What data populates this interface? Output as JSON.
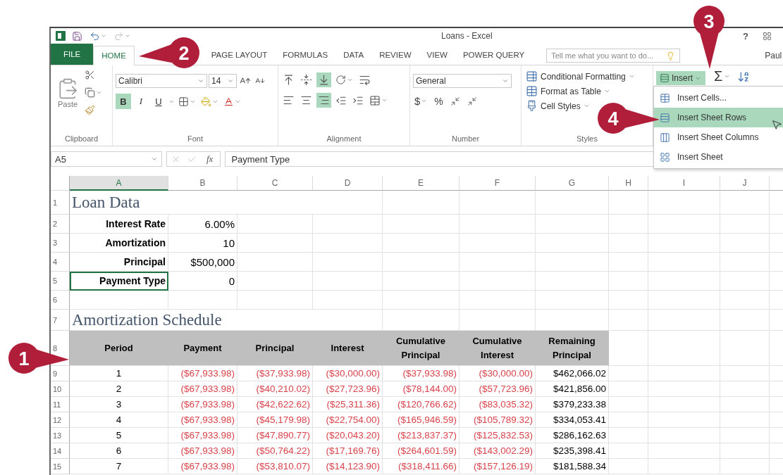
{
  "window": {
    "title": "Loans - Excel",
    "help": "?",
    "user": "Paul"
  },
  "tabs": [
    {
      "label": "FILE",
      "kind": "file",
      "selected": false
    },
    {
      "label": "HOME",
      "kind": "tab",
      "selected": true
    },
    {
      "label": "PAGE LAYOUT",
      "kind": "tab",
      "selected": false
    },
    {
      "label": "FORMULAS",
      "kind": "tab",
      "selected": false
    },
    {
      "label": "DATA",
      "kind": "tab",
      "selected": false
    },
    {
      "label": "REVIEW",
      "kind": "tab",
      "selected": false
    },
    {
      "label": "VIEW",
      "kind": "tab",
      "selected": false
    },
    {
      "label": "POWER QUERY",
      "kind": "tab",
      "selected": false
    }
  ],
  "tell_me": {
    "placeholder": "Tell me what you want to do..."
  },
  "ribbon": {
    "clipboard": {
      "paste": "Paste",
      "group": "Clipboard"
    },
    "font": {
      "name": "Calibri",
      "size": "14",
      "bold_label": "B",
      "italic_label": "I",
      "underline_label": "U",
      "bold": true,
      "group": "Font"
    },
    "alignment": {
      "vertical": [
        {
          "selected": false
        },
        {
          "selected": false
        },
        {
          "selected": true
        }
      ],
      "horizontal": [
        {
          "selected": false
        },
        {
          "selected": false
        },
        {
          "selected": true
        }
      ],
      "group": "Alignment"
    },
    "number": {
      "format": "General",
      "currency": "$",
      "percent": "%",
      "group": "Number"
    },
    "styles": {
      "items": [
        "Conditional Formatting",
        "Format as Table",
        "Cell Styles"
      ],
      "group": "Styles"
    },
    "cells": {
      "insert": "Insert",
      "open": true
    },
    "editing": {
      "sum": "Σ"
    }
  },
  "insert_menu": [
    {
      "label": "Insert Cells...",
      "selected": false
    },
    {
      "label": "Insert Sheet Rows",
      "selected": true
    },
    {
      "label": "Insert Sheet Columns",
      "selected": false
    },
    {
      "label": "Insert Sheet",
      "selected": false
    }
  ],
  "formula_bar": {
    "name_box": "A5",
    "function_label": "fx",
    "value": "Payment Type"
  },
  "columns": [
    {
      "label": "A",
      "selected": true
    },
    {
      "label": "B",
      "selected": false
    },
    {
      "label": "C",
      "selected": false
    },
    {
      "label": "D",
      "selected": false
    },
    {
      "label": "E",
      "selected": false
    },
    {
      "label": "F",
      "selected": false
    },
    {
      "label": "G",
      "selected": false
    },
    {
      "label": "H",
      "selected": false
    },
    {
      "label": "I",
      "selected": false
    },
    {
      "label": "J",
      "selected": false
    }
  ],
  "rows": [
    {
      "number": "1",
      "kind": "title",
      "cells": [
        "Loan Data"
      ]
    },
    {
      "number": "2",
      "kind": "param",
      "selected": false,
      "cells": [
        "Interest Rate",
        "6.00%"
      ]
    },
    {
      "number": "3",
      "kind": "param",
      "selected": false,
      "cells": [
        "Amortization",
        "10"
      ]
    },
    {
      "number": "4",
      "kind": "param",
      "selected": false,
      "cells": [
        "Principal",
        "$500,000"
      ]
    },
    {
      "number": "5",
      "kind": "param",
      "selected": true,
      "cells": [
        "Payment Type",
        "0"
      ]
    },
    {
      "number": "6",
      "kind": "blank"
    },
    {
      "number": "7",
      "kind": "title",
      "cells": [
        "Amortization Schedule"
      ]
    },
    {
      "number": "8",
      "kind": "header",
      "cells": [
        "Period",
        "Payment",
        "Principal",
        "Interest",
        "Cumulative Principal",
        "Cumulative Interest",
        "Remaining Principal"
      ]
    },
    {
      "number": "9",
      "kind": "data",
      "cells": [
        {
          "text": "1",
          "negative": false
        },
        {
          "text": "($67,933.98)",
          "negative": true
        },
        {
          "text": "($37,933.98)",
          "negative": true
        },
        {
          "text": "($30,000.00)",
          "negative": true
        },
        {
          "text": "($37,933.98)",
          "negative": true
        },
        {
          "text": "($30,000.00)",
          "negative": true
        },
        {
          "text": "$462,066.02",
          "negative": false
        }
      ]
    },
    {
      "number": "10",
      "kind": "data",
      "cells": [
        {
          "text": "2",
          "negative": false
        },
        {
          "text": "($67,933.98)",
          "negative": true
        },
        {
          "text": "($40,210.02)",
          "negative": true
        },
        {
          "text": "($27,723.96)",
          "negative": true
        },
        {
          "text": "($78,144.00)",
          "negative": true
        },
        {
          "text": "($57,723.96)",
          "negative": true
        },
        {
          "text": "$421,856.00",
          "negative": false
        }
      ]
    },
    {
      "number": "11",
      "kind": "data",
      "cells": [
        {
          "text": "3",
          "negative": false
        },
        {
          "text": "($67,933.98)",
          "negative": true
        },
        {
          "text": "($42,622.62)",
          "negative": true
        },
        {
          "text": "($25,311.36)",
          "negative": true
        },
        {
          "text": "($120,766.62)",
          "negative": true
        },
        {
          "text": "($83,035.32)",
          "negative": true
        },
        {
          "text": "$379,233.38",
          "negative": false
        }
      ]
    },
    {
      "number": "12",
      "kind": "data",
      "cells": [
        {
          "text": "4",
          "negative": false
        },
        {
          "text": "($67,933.98)",
          "negative": true
        },
        {
          "text": "($45,179.98)",
          "negative": true
        },
        {
          "text": "($22,754.00)",
          "negative": true
        },
        {
          "text": "($165,946.59)",
          "negative": true
        },
        {
          "text": "($105,789.32)",
          "negative": true
        },
        {
          "text": "$334,053.41",
          "negative": false
        }
      ]
    },
    {
      "number": "13",
      "kind": "data",
      "cells": [
        {
          "text": "5",
          "negative": false
        },
        {
          "text": "($67,933.98)",
          "negative": true
        },
        {
          "text": "($47,890.77)",
          "negative": true
        },
        {
          "text": "($20,043.20)",
          "negative": true
        },
        {
          "text": "($213,837.37)",
          "negative": true
        },
        {
          "text": "($125,832.53)",
          "negative": true
        },
        {
          "text": "$286,162.63",
          "negative": false
        }
      ]
    },
    {
      "number": "14",
      "kind": "data",
      "cells": [
        {
          "text": "6",
          "negative": false
        },
        {
          "text": "($67,933.98)",
          "negative": true
        },
        {
          "text": "($50,764.22)",
          "negative": true
        },
        {
          "text": "($17,169.76)",
          "negative": true
        },
        {
          "text": "($264,601.59)",
          "negative": true
        },
        {
          "text": "($143,002.29)",
          "negative": true
        },
        {
          "text": "$235,398.41",
          "negative": false
        }
      ]
    },
    {
      "number": "15",
      "kind": "data",
      "cells": [
        {
          "text": "7",
          "negative": false
        },
        {
          "text": "($67,933.98)",
          "negative": true
        },
        {
          "text": "($53,810.07)",
          "negative": true
        },
        {
          "text": "($14,123.90)",
          "negative": true
        },
        {
          "text": "($318,411.66)",
          "negative": true
        },
        {
          "text": "($157,126.19)",
          "negative": true
        },
        {
          "text": "$181,588.34",
          "negative": false
        }
      ]
    }
  ],
  "callouts": [
    {
      "number": "1"
    },
    {
      "number": "2"
    },
    {
      "number": "3"
    },
    {
      "number": "4"
    }
  ]
}
